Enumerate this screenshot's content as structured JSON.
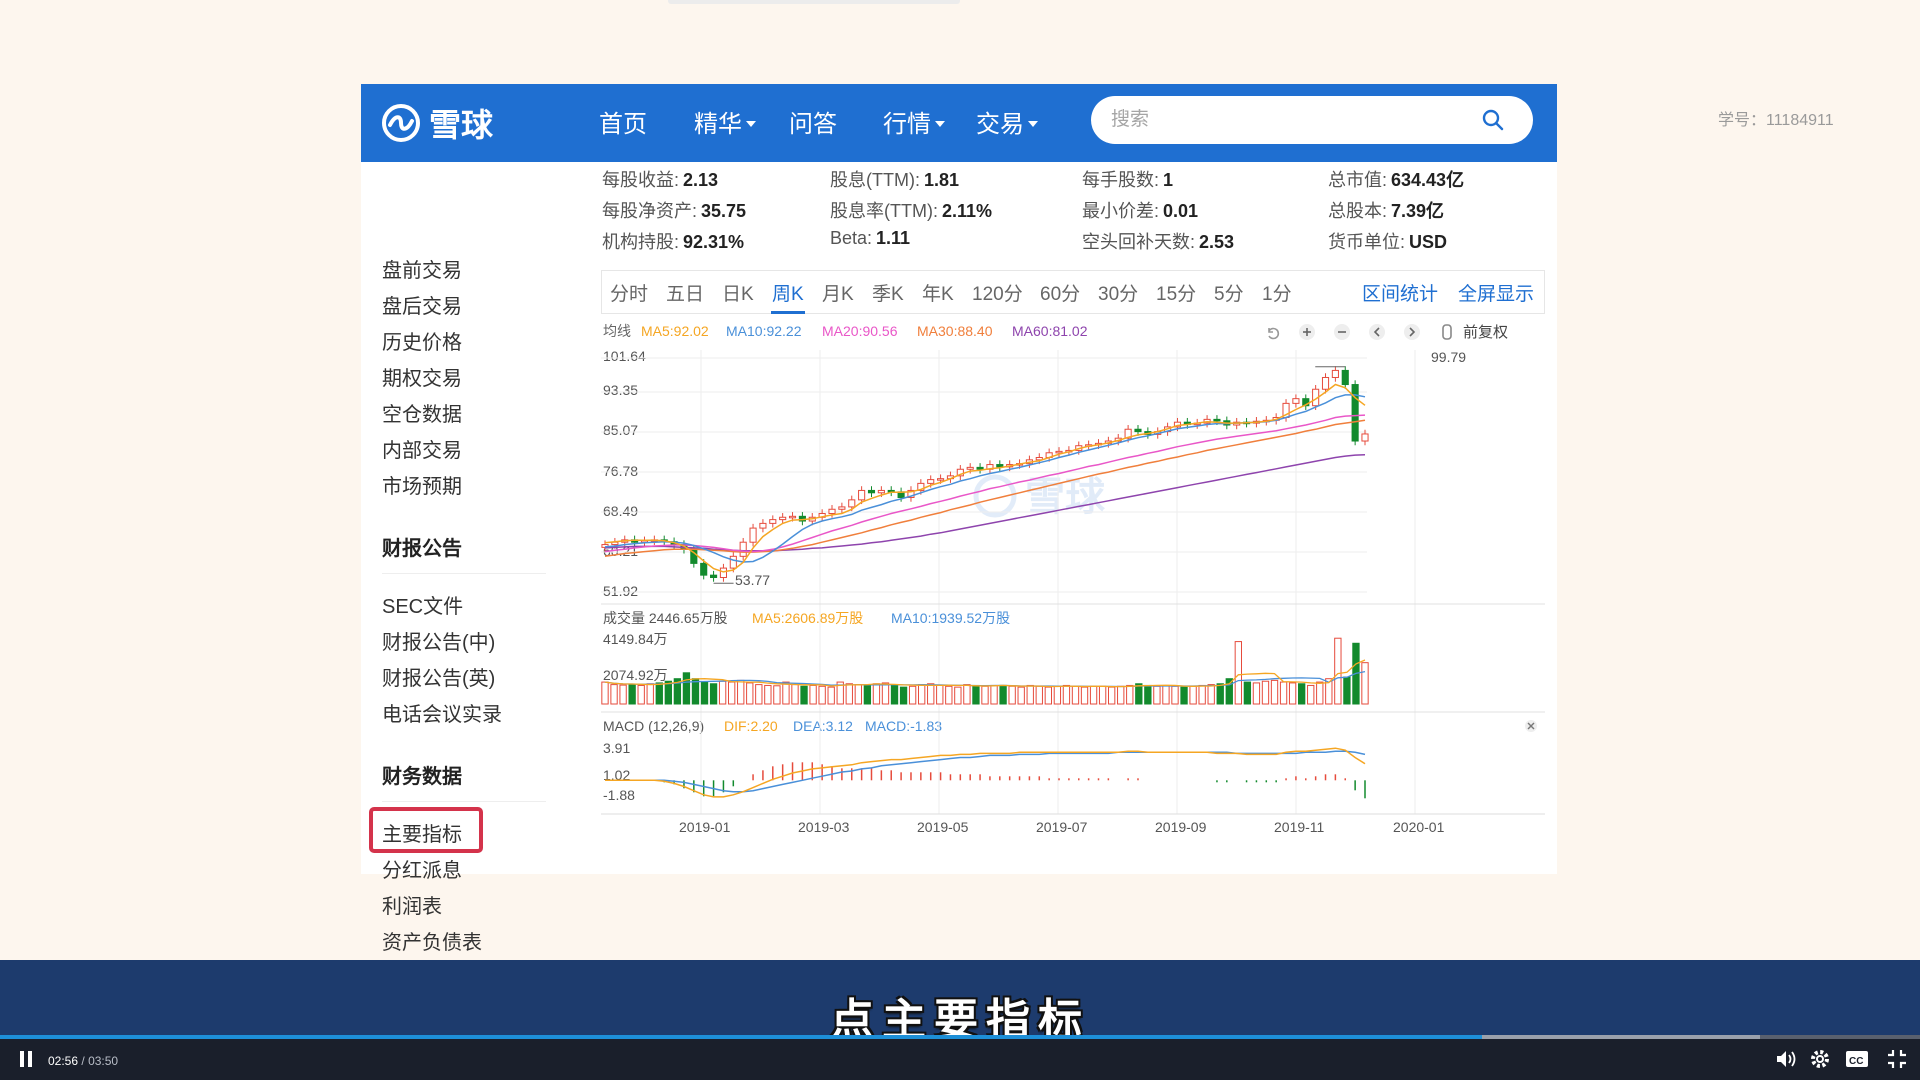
{
  "watermark": "学号：11184911",
  "brand": {
    "name": "雪球",
    "primary_color": "#1f6fd1"
  },
  "nav": {
    "items": [
      {
        "label": "首页",
        "dropdown": false
      },
      {
        "label": "精华",
        "dropdown": true
      },
      {
        "label": "问答",
        "dropdown": false
      },
      {
        "label": "行情",
        "dropdown": true
      },
      {
        "label": "交易",
        "dropdown": true
      }
    ],
    "search_placeholder": "搜索"
  },
  "sidebar": {
    "items_top": [
      "盘前交易",
      "盘后交易",
      "历史价格",
      "期权交易",
      "空仓数据",
      "内部交易",
      "市场预期"
    ],
    "section1": {
      "title": "财报公告",
      "items": [
        "SEC文件",
        "财报公告(中)",
        "财报公告(英)",
        "电话会议实录"
      ]
    },
    "section2": {
      "title": "财务数据",
      "items": [
        "主要指标",
        "分红派息",
        "利润表",
        "资产负债表"
      ],
      "highlighted": "主要指标"
    }
  },
  "stats": [
    [
      {
        "label": "每股收益:",
        "value": "2.13"
      },
      {
        "label": "股息(TTM):",
        "value": "1.81"
      },
      {
        "label": "每手股数:",
        "value": "1"
      },
      {
        "label": "总市值:",
        "value": "634.43亿"
      }
    ],
    [
      {
        "label": "每股净资产:",
        "value": "35.75"
      },
      {
        "label": "股息率(TTM):",
        "value": "2.11%"
      },
      {
        "label": "最小价差:",
        "value": "0.01"
      },
      {
        "label": "总股本:",
        "value": "7.39亿"
      }
    ],
    [
      {
        "label": "机构持股:",
        "value": "92.31%"
      },
      {
        "label": "Beta:",
        "value": "1.11"
      },
      {
        "label": "空头回补天数:",
        "value": "2.53"
      },
      {
        "label": "货币单位:",
        "value": "USD"
      }
    ]
  ],
  "chart_tabs": [
    "分时",
    "五日",
    "日K",
    "周K",
    "月K",
    "季K",
    "年K",
    "120分",
    "60分",
    "30分",
    "15分",
    "5分",
    "1分"
  ],
  "chart_tab_active": "周K",
  "chart_links": [
    "区间统计",
    "全屏显示"
  ],
  "chart_tools": {
    "icons": [
      "undo-icon",
      "zoom-in-icon",
      "zoom-out-icon",
      "chevron-left-icon",
      "chevron-right-icon",
      "pin-icon"
    ],
    "adjust_label": "前复权"
  },
  "colors": {
    "up": "#e64b3c",
    "down": "#128a2d",
    "ma5": "#f5a623",
    "ma10": "#4a90d9",
    "ma20": "#e957c8",
    "ma30": "#f07f3c",
    "ma60": "#8e44ad",
    "dif": "#f5a623",
    "dea": "#4a90d9"
  },
  "chart_data": [
    {
      "type": "candlestick",
      "title": "",
      "ma_legend": {
        "label": "均线",
        "entries": [
          "MA5:92.02",
          "MA10:92.22",
          "MA20:90.56",
          "MA30:88.40",
          "MA60:81.02"
        ]
      },
      "y_ticks": [
        "101.64",
        "93.35",
        "85.07",
        "76.78",
        "68.49",
        "60.21",
        "51.92"
      ],
      "ylim": [
        51.92,
        101.64
      ],
      "x_ticks": [
        "2019-01",
        "2019-03",
        "2019-05",
        "2019-07",
        "2019-09",
        "2019-11",
        "2020-01"
      ],
      "annotations": [
        {
          "text": "99.79",
          "value": 99.79
        },
        {
          "text": "53.77",
          "value": 53.77
        }
      ],
      "close_series": [
        62,
        62.5,
        63,
        62.5,
        62.8,
        63,
        62.6,
        62,
        61,
        58,
        55.5,
        55,
        57,
        59.5,
        62.5,
        65.5,
        66.5,
        67.3,
        67.8,
        68,
        67,
        67.8,
        68.6,
        69.5,
        70,
        71.5,
        73.5,
        73,
        73.5,
        73.2,
        72,
        73.5,
        75,
        75.8,
        76,
        76.6,
        78,
        78.4,
        78,
        79,
        78.5,
        79,
        79.2,
        80,
        80.5,
        81.5,
        81.8,
        82,
        83,
        83.2,
        83.5,
        84,
        84.6,
        86.5,
        86,
        85.4,
        86,
        87,
        88,
        87.5,
        87.8,
        88.6,
        88.3,
        87.4,
        88,
        87.8,
        88.2,
        88.4,
        89,
        92,
        93,
        91.5,
        95,
        97.5,
        99,
        96,
        84,
        85.5
      ],
      "ma5": [
        62.4,
        62.6,
        62.8,
        62.9,
        62.9,
        62.9,
        62.8,
        62.4,
        61.7,
        60.3,
        58.5,
        56.9,
        56.2,
        56.6,
        58.2,
        61.3,
        63.7,
        65.2,
        66.5,
        67.2,
        67.3,
        67.5,
        67.9,
        68.3,
        68.6,
        69.5,
        71,
        71.8,
        72.5,
        73.1,
        73.1,
        73.2,
        73.7,
        74.6,
        75.2,
        76,
        76.9,
        77.6,
        77.8,
        78.1,
        78.3,
        78.7,
        79.1,
        79.5,
        79.8,
        80.5,
        81.2,
        81.7,
        82.4,
        82.9,
        83.2,
        83.6,
        84.1,
        84.8,
        85.3,
        85.6,
        86,
        86.6,
        87.3,
        87.5,
        87.8,
        88.1,
        88,
        87.8,
        87.8,
        87.9,
        88,
        88.2,
        88.6,
        89.6,
        90.7,
        91.7,
        92.9,
        94.4,
        96,
        95.3,
        93.2,
        91.6
      ],
      "ma10": [
        61.5,
        61.7,
        62,
        62.2,
        62.4,
        62.5,
        62.6,
        62.5,
        62.3,
        61.8,
        61.1,
        60.3,
        59.4,
        58.7,
        58.3,
        58.4,
        59.3,
        60.6,
        62.1,
        63.7,
        65.2,
        66.3,
        67,
        67.5,
        67.9,
        68.4,
        69.3,
        69.9,
        70.5,
        71.2,
        71.7,
        72.3,
        73,
        73.7,
        74.3,
        74.8,
        75.5,
        76,
        76.6,
        77.1,
        77.5,
        78,
        78.4,
        78.9,
        79.4,
        79.9,
        80.5,
        81,
        81.6,
        82.1,
        82.6,
        83.1,
        83.6,
        84.2,
        84.7,
        85.1,
        85.6,
        86.1,
        86.6,
        86.9,
        87.2,
        87.5,
        87.7,
        87.7,
        87.8,
        87.9,
        88,
        88.1,
        88.4,
        89,
        89.7,
        90.3,
        91.2,
        92.1,
        93.2,
        93.8,
        93.8,
        93.4
      ],
      "ma20": [
        60.5,
        60.8,
        61,
        61.3,
        61.5,
        61.7,
        61.8,
        61.9,
        61.9,
        61.8,
        61.6,
        61.4,
        61.1,
        60.8,
        60.6,
        60.5,
        60.7,
        61,
        61.5,
        62.1,
        62.8,
        63.5,
        64.2,
        64.9,
        65.5,
        66.1,
        66.8,
        67.4,
        68,
        68.6,
        69.1,
        69.6,
        70.1,
        70.7,
        71.2,
        71.7,
        72.3,
        72.8,
        73.3,
        73.9,
        74.3,
        74.8,
        75.3,
        75.7,
        76.2,
        76.7,
        77.1,
        77.6,
        78.1,
        78.6,
        79,
        79.5,
        80,
        80.5,
        80.9,
        81.4,
        81.8,
        82.3,
        82.8,
        83.2,
        83.6,
        84,
        84.4,
        84.7,
        85,
        85.3,
        85.6,
        85.9,
        86.2,
        86.6,
        87,
        87.4,
        87.9,
        88.4,
        89,
        89.3,
        89.4,
        89.5
      ],
      "ma30": [
        59.5,
        59.8,
        60.1,
        60.3,
        60.5,
        60.7,
        60.9,
        61,
        61,
        61,
        60.9,
        60.8,
        60.7,
        60.5,
        60.4,
        60.4,
        60.5,
        60.6,
        60.9,
        61.2,
        61.6,
        62,
        62.5,
        63,
        63.5,
        64,
        64.5,
        65.1,
        65.6,
        66.2,
        66.7,
        67.2,
        67.8,
        68.3,
        68.8,
        69.4,
        69.9,
        70.4,
        71,
        71.5,
        72,
        72.5,
        73,
        73.5,
        74,
        74.5,
        75,
        75.5,
        76,
        76.5,
        77,
        77.4,
        77.9,
        78.4,
        78.8,
        79.3,
        79.7,
        80.2,
        80.6,
        81.1,
        81.5,
        82,
        82.4,
        82.8,
        83.2,
        83.6,
        84,
        84.4,
        84.8,
        85.2,
        85.6,
        86.1,
        86.5,
        87,
        87.5,
        87.8,
        88.1,
        88.4
      ],
      "ma60": [
        61.3,
        61.4,
        61.5,
        61.6,
        61.6,
        61.6,
        61.6,
        61.5,
        61.4,
        61.3,
        61.2,
        61,
        60.9,
        60.8,
        60.7,
        60.7,
        60.7,
        60.7,
        60.8,
        60.9,
        61,
        61.2,
        61.3,
        61.5,
        61.7,
        61.9,
        62.1,
        62.4,
        62.6,
        62.9,
        63.2,
        63.5,
        63.8,
        64.2,
        64.5,
        64.9,
        65.3,
        65.7,
        66.1,
        66.5,
        66.9,
        67.3,
        67.7,
        68.1,
        68.5,
        68.9,
        69.3,
        69.7,
        70.1,
        70.5,
        70.9,
        71.3,
        71.7,
        72.1,
        72.5,
        72.9,
        73.3,
        73.7,
        74.1,
        74.5,
        74.9,
        75.3,
        75.7,
        76.1,
        76.5,
        76.9,
        77.3,
        77.7,
        78.1,
        78.5,
        78.9,
        79.3,
        79.7,
        80.1,
        80.5,
        80.8,
        81,
        81.1
      ]
    },
    {
      "type": "bar",
      "title": "",
      "legend": [
        "成交量 2446.65万股",
        "MA5:2606.89万股",
        "MA10:1939.52万股"
      ],
      "y_ticks": [
        "4149.84万",
        "2074.92万"
      ],
      "ylim": [
        0,
        4149.84
      ],
      "unit": "万股",
      "values_note": "weekly volume bars, approximate",
      "values": [
        1300,
        1150,
        1120,
        1180,
        1100,
        1200,
        1250,
        1350,
        1500,
        1850,
        1500,
        1300,
        1200,
        1350,
        1300,
        1400,
        1250,
        1150,
        1100,
        1080,
        1300,
        1150,
        1050,
        1100,
        1050,
        1000,
        1300,
        1200,
        1150,
        1100,
        1200,
        1250,
        1100,
        1000,
        1050,
        1150,
        1200,
        1100,
        1050,
        1000,
        1150,
        1100,
        1050,
        1100,
        1100,
        1050,
        1000,
        1100,
        1050,
        1000,
        1050,
        1100,
        1050,
        1000,
        1050,
        1050,
        1000,
        1050,
        1100,
        1200,
        1100,
        1050,
        1100,
        1050,
        1000,
        1050,
        1100,
        1150,
        1200,
        1500,
        3700,
        1300,
        1250,
        1350,
        1400,
        1300,
        1250,
        1200,
        1100,
        1300,
        1500,
        3900,
        1600,
        3600,
        2450
      ]
    },
    {
      "type": "line",
      "title": "",
      "legend": [
        "MACD (12,26,9)",
        "DIF:2.20",
        "DEA:3.12",
        "MACD:-1.83"
      ],
      "y_ticks": [
        "3.91",
        "1.02",
        "-1.88"
      ],
      "ylim": [
        -1.88,
        3.91
      ],
      "dif": [
        0.6,
        0.6,
        0.6,
        0.6,
        0.6,
        0.6,
        0.5,
        0.3,
        0.0,
        -0.4,
        -0.8,
        -1.0,
        -1.0,
        -0.8,
        -0.5,
        -0.1,
        0.3,
        0.7,
        1.0,
        1.3,
        1.5,
        1.7,
        1.8,
        1.9,
        2.0,
        2.1,
        2.3,
        2.4,
        2.5,
        2.6,
        2.6,
        2.7,
        2.8,
        2.9,
        3.0,
        3.0,
        3.1,
        3.1,
        3.2,
        3.2,
        3.2,
        3.2,
        3.3,
        3.3,
        3.3,
        3.3,
        3.3,
        3.3,
        3.3,
        3.3,
        3.3,
        3.3,
        3.3,
        3.4,
        3.4,
        3.3,
        3.3,
        3.3,
        3.3,
        3.3,
        3.3,
        3.3,
        3.2,
        3.2,
        3.2,
        3.1,
        3.1,
        3.1,
        3.1,
        3.3,
        3.4,
        3.4,
        3.5,
        3.6,
        3.7,
        3.5,
        2.8,
        2.2
      ],
      "dea": [
        0.6,
        0.6,
        0.6,
        0.6,
        0.6,
        0.6,
        0.6,
        0.5,
        0.4,
        0.2,
        0.0,
        -0.2,
        -0.4,
        -0.5,
        -0.5,
        -0.4,
        -0.2,
        0.0,
        0.2,
        0.4,
        0.6,
        0.8,
        1.0,
        1.2,
        1.4,
        1.5,
        1.7,
        1.8,
        2.0,
        2.1,
        2.2,
        2.3,
        2.4,
        2.5,
        2.6,
        2.7,
        2.8,
        2.8,
        2.9,
        3.0,
        3.0,
        3.0,
        3.1,
        3.1,
        3.1,
        3.2,
        3.2,
        3.2,
        3.2,
        3.2,
        3.2,
        3.2,
        3.3,
        3.3,
        3.3,
        3.3,
        3.3,
        3.3,
        3.3,
        3.3,
        3.3,
        3.3,
        3.3,
        3.3,
        3.2,
        3.2,
        3.2,
        3.2,
        3.2,
        3.2,
        3.2,
        3.3,
        3.3,
        3.3,
        3.4,
        3.4,
        3.3,
        3.1
      ]
    }
  ],
  "subtitle": "点主要指标",
  "player": {
    "current_time": "02:56",
    "total_time": "03:50",
    "separator": "/",
    "progress": 0.772
  }
}
